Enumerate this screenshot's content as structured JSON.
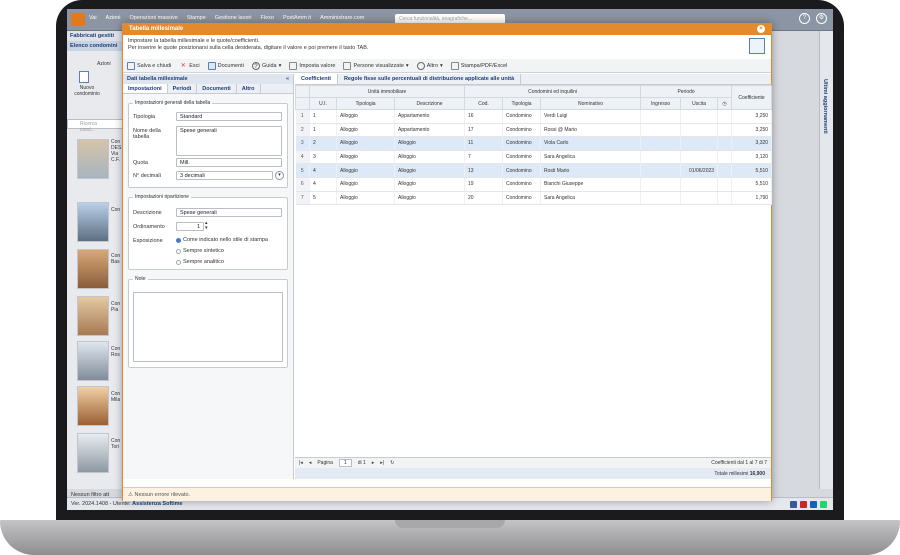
{
  "app": {
    "menu": [
      "Vai",
      "Azioni",
      "Operazioni massive",
      "Stampe",
      "Gestione lavori",
      "Flexo",
      "PostAmm it",
      "Amministrare.com"
    ],
    "search_placeholder": "Cerca funzionalità, anagrafiche...",
    "left_title": "Fabbricati gestiti",
    "left_tab": "Elenco condomini",
    "left_actions_label": "Azioni",
    "new_condominio": "Nuovo condominio",
    "left_search": "Ricerca cond...",
    "left_items": [
      "Con DES Via C.F.",
      "Con",
      "Con Bas",
      "Con Pia",
      "Con Ros",
      "Con Mila",
      "Con Tori"
    ],
    "filter_label": "Nessun filtro att",
    "right_vertical": "Ultimi aggiornamenti",
    "version": "Ver. 2024.1408 - Utente:",
    "user": "Assistenza Softime"
  },
  "dialog": {
    "title": "Tabella millesimale",
    "intro_line1": "Impostare la tabella millesimale e le quote/coefficienti.",
    "intro_line2": "Per inserire le quote posizionarsi sulla cella desiderata, digitare il valore e poi premere il tasto TAB.",
    "toolbar": [
      "Salva e chiudi",
      "Esci",
      "Documenti",
      "Guida",
      "Imposta valore",
      "Persone visualizzate",
      "Altro",
      "Stampa/PDF/Excel"
    ],
    "status": "Nessun errore rilevato."
  },
  "form": {
    "panel_title": "Dati tabella millesimale",
    "tabs": [
      "Impostazioni",
      "Periodi",
      "Documenti",
      "Altro"
    ],
    "group1": "Impostazioni generali della tabella",
    "tipologia_label": "Tipologia",
    "tipologia": "Standard",
    "nome_label": "Nome della tabella",
    "nome": "Spese generali",
    "quota_label": "Quota",
    "quota": "Mill.",
    "decimali_label": "N° decimali",
    "decimali": "3 decimali",
    "group2": "Impostazioni ripartizione",
    "descrizione_label": "Descrizione",
    "descrizione": "Spese generali",
    "ordinamento_label": "Ordinamento",
    "ordinamento": "1",
    "esposizione_label": "Esposizione",
    "esposizione_options": [
      "Come indicato nello stile di stampa",
      "Sempre sintetico",
      "Sempre analitico"
    ],
    "note_label": "Note"
  },
  "table": {
    "tabs": [
      "Coefficienti",
      "Regole fisse sulle percentuali di distribuzione applicate alle unità"
    ],
    "group_headers": [
      "Unità immobiliare",
      "Condomini ed inquilini",
      "Periodo",
      "Coefficiente"
    ],
    "columns": [
      "U.I.",
      "Tipologia",
      "Descrizione",
      "Cod.",
      "Tipologia",
      "Nominativo",
      "Ingresso",
      "Uscita"
    ],
    "rows": [
      {
        "n": "1",
        "ui": "1",
        "tip": "Alloggio",
        "desc": "Appartamento",
        "cod": "16",
        "tip2": "Condomino",
        "nom": "Verdi Luigi",
        "ing": "",
        "usc": "",
        "coef": "3,250"
      },
      {
        "n": "2",
        "ui": "1",
        "tip": "Alloggio",
        "desc": "Appartamento",
        "cod": "17",
        "tip2": "Condomino",
        "nom": "Rossi @ Mario",
        "ing": "",
        "usc": "",
        "coef": "3,250"
      },
      {
        "n": "3",
        "ui": "2",
        "tip": "Alloggio",
        "desc": "Alloggio",
        "cod": "11",
        "tip2": "Condomino",
        "nom": "Viola Carlo",
        "ing": "",
        "usc": "",
        "coef": "3,320"
      },
      {
        "n": "4",
        "ui": "3",
        "tip": "Alloggio",
        "desc": "Alloggio",
        "cod": "7",
        "tip2": "Condomino",
        "nom": "Sara Angelica",
        "ing": "",
        "usc": "",
        "coef": "3,120"
      },
      {
        "n": "5",
        "ui": "4",
        "tip": "Alloggio",
        "desc": "Alloggio",
        "cod": "13",
        "tip2": "Condomino",
        "nom": "Rosti Mario",
        "ing": "",
        "usc": "01/06/2023",
        "coef": "5,510"
      },
      {
        "n": "6",
        "ui": "4",
        "tip": "Alloggio",
        "desc": "Alloggio",
        "cod": "19",
        "tip2": "Condomino",
        "nom": "Bianchi Giuseppe",
        "ing": "",
        "usc": "",
        "coef": "5,510"
      },
      {
        "n": "7",
        "ui": "5",
        "tip": "Alloggio",
        "desc": "Alloggio",
        "cod": "20",
        "tip2": "Condomino",
        "nom": "Sara Angelica",
        "ing": "",
        "usc": "",
        "coef": "1,790"
      }
    ],
    "page_label": "Pagina",
    "page": "1",
    "page_of": "di 1",
    "count": "Coefficienti dal 1 al 7 di 7",
    "total_label": "Totale millesimi",
    "total": "16,900"
  }
}
